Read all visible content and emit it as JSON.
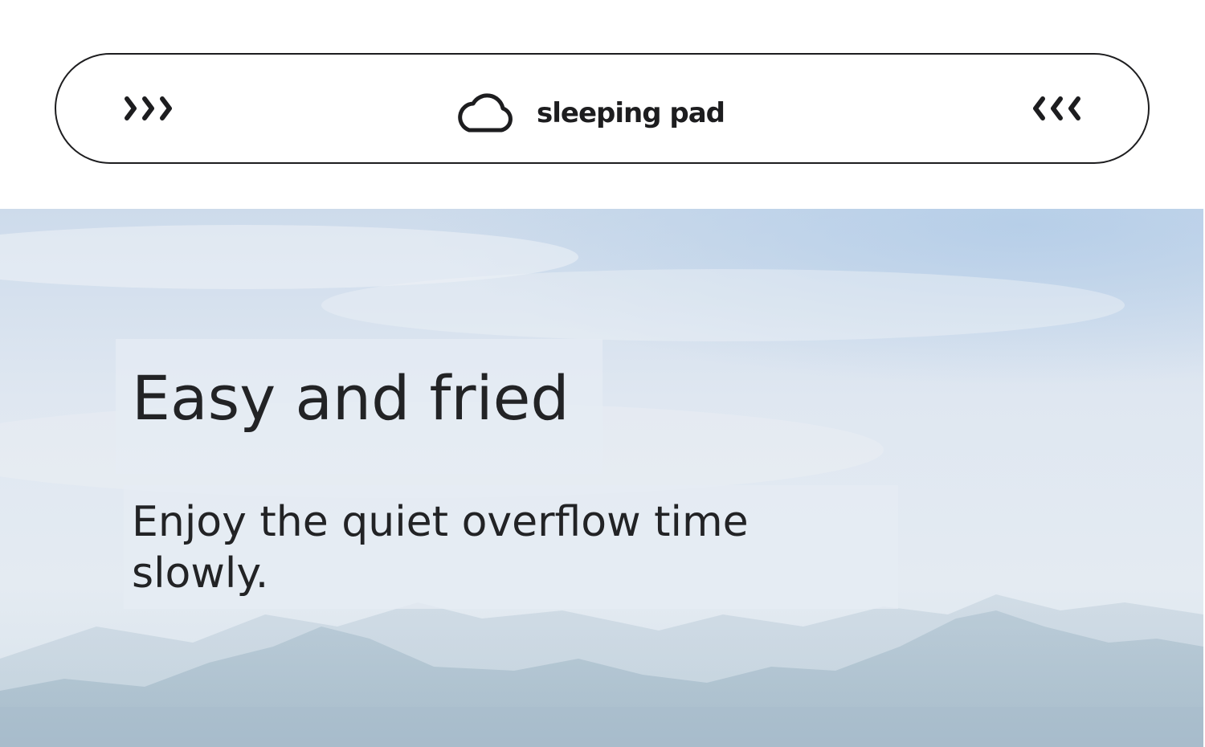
{
  "header": {
    "brand": {
      "name": "sleeping pad",
      "logo_icon": "cloud-icon"
    },
    "left_nav_icon": "chevrons-right-icon",
    "right_nav_icon": "chevrons-left-icon"
  },
  "hero": {
    "headline": "Easy and fried",
    "subtitle": "Enjoy the quiet overflow time slowly."
  },
  "colors": {
    "text": "#222325",
    "border": "#1d1d1f",
    "sky": "#dce6f0"
  }
}
